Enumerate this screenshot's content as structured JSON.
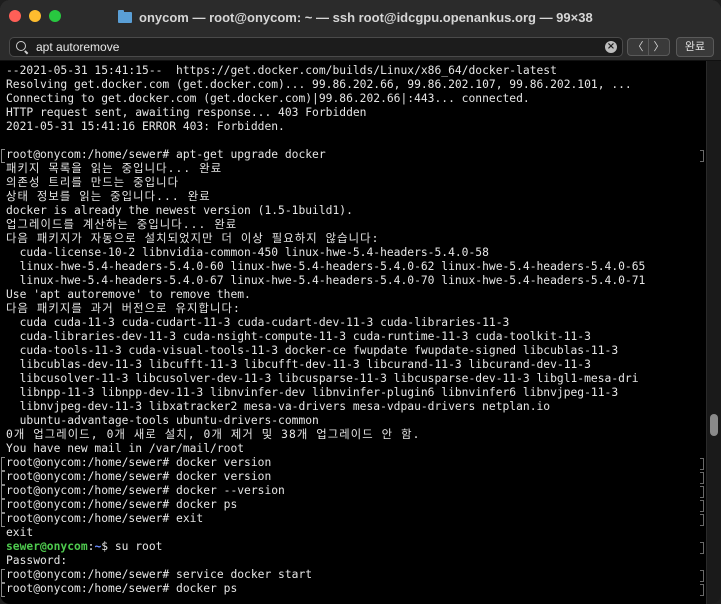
{
  "window": {
    "title": "onycom — root@onycom: ~ — ssh root@idcgpu.openankus.org — 99×38"
  },
  "search": {
    "value": "apt autoremove",
    "clear_glyph": "×",
    "prev_glyph": "〈",
    "next_glyph": "〉",
    "done_label": "완료"
  },
  "terminal": {
    "lines": [
      "--2021-05-31 15:41:15--  https://get.docker.com/builds/Linux/x86_64/docker-latest",
      "Resolving get.docker.com (get.docker.com)... 99.86.202.66, 99.86.202.107, 99.86.202.101, ...",
      "Connecting to get.docker.com (get.docker.com)|99.86.202.66|:443... connected.",
      "HTTP request sent, awaiting response... 403 Forbidden",
      "2021-05-31 15:41:16 ERROR 403: Forbidden.",
      "",
      "root@onycom:/home/sewer# apt-get upgrade docker",
      "패키지 목록을 읽는 중입니다... 완료",
      "의존성 트리를 만드는 중입니다",
      "상태 정보를 읽는 중입니다... 완료",
      "docker is already the newest version (1.5-1build1).",
      "업그레이드를 계산하는 중입니다... 완료",
      "다음 패키지가 자동으로 설치되었지만 더 이상 필요하지 않습니다:",
      "  cuda-license-10-2 libnvidia-common-450 linux-hwe-5.4-headers-5.4.0-58",
      "  linux-hwe-5.4-headers-5.4.0-60 linux-hwe-5.4-headers-5.4.0-62 linux-hwe-5.4-headers-5.4.0-65",
      "  linux-hwe-5.4-headers-5.4.0-67 linux-hwe-5.4-headers-5.4.0-70 linux-hwe-5.4-headers-5.4.0-71",
      "Use 'apt autoremove' to remove them.",
      "다음 패키지를 과거 버전으로 유지합니다:",
      "  cuda cuda-11-3 cuda-cudart-11-3 cuda-cudart-dev-11-3 cuda-libraries-11-3",
      "  cuda-libraries-dev-11-3 cuda-nsight-compute-11-3 cuda-runtime-11-3 cuda-toolkit-11-3",
      "  cuda-tools-11-3 cuda-visual-tools-11-3 docker-ce fwupdate fwupdate-signed libcublas-11-3",
      "  libcublas-dev-11-3 libcufft-11-3 libcufft-dev-11-3 libcurand-11-3 libcurand-dev-11-3",
      "  libcusolver-11-3 libcusolver-dev-11-3 libcusparse-11-3 libcusparse-dev-11-3 libgl1-mesa-dri",
      "  libnpp-11-3 libnpp-dev-11-3 libnvinfer-dev libnvinfer-plugin6 libnvinfer6 libnvjpeg-11-3",
      "  libnvjpeg-dev-11-3 libxatracker2 mesa-va-drivers mesa-vdpau-drivers netplan.io",
      "  ubuntu-advantage-tools ubuntu-drivers-common",
      "0개 업그레이드, 0개 새로 설치, 0개 제거 및 38개 업그레이드 안 함.",
      "You have new mail in /var/mail/root",
      "root@onycom:/home/sewer# docker version",
      "root@onycom:/home/sewer# docker version",
      "root@onycom:/home/sewer# docker --version",
      "root@onycom:/home/sewer# docker ps",
      "root@onycom:/home/sewer# exit",
      "exit",
      "sewer@onycom:~$ su root",
      "Password:",
      "root@onycom:/home/sewer# service docker start",
      "root@onycom:/home/sewer# docker ps"
    ],
    "colored_prompt": {
      "user_host": "sewer@onycom",
      "sep": ":",
      "path": "~",
      "rest": "$ su root"
    },
    "colors": {
      "background": "#000000",
      "text": "#e6e6e6",
      "prompt_user": "#4ec94e",
      "prompt_path": "#6a8cff"
    }
  }
}
